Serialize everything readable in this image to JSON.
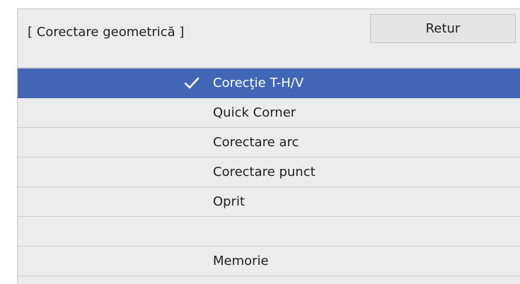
{
  "header": {
    "title": "[ Corectare geometrică ]",
    "return_label": "Retur"
  },
  "menu": {
    "items": [
      {
        "label": "Corecţie T-H/V",
        "selected": true,
        "checked": true
      },
      {
        "label": "Quick Corner",
        "selected": false,
        "checked": false
      },
      {
        "label": "Corectare arc",
        "selected": false,
        "checked": false
      },
      {
        "label": "Corectare punct",
        "selected": false,
        "checked": false
      },
      {
        "label": "Oprit",
        "selected": false,
        "checked": false
      },
      {
        "label": "",
        "selected": false,
        "checked": false
      },
      {
        "label": "Memorie",
        "selected": false,
        "checked": false
      }
    ]
  },
  "icons": {
    "selected_check": "checkmark-icon"
  },
  "colors": {
    "selection": "#4066b5",
    "panel_background": "#ececec",
    "text": "#1f1f1f",
    "selected_text": "#ffffff"
  }
}
